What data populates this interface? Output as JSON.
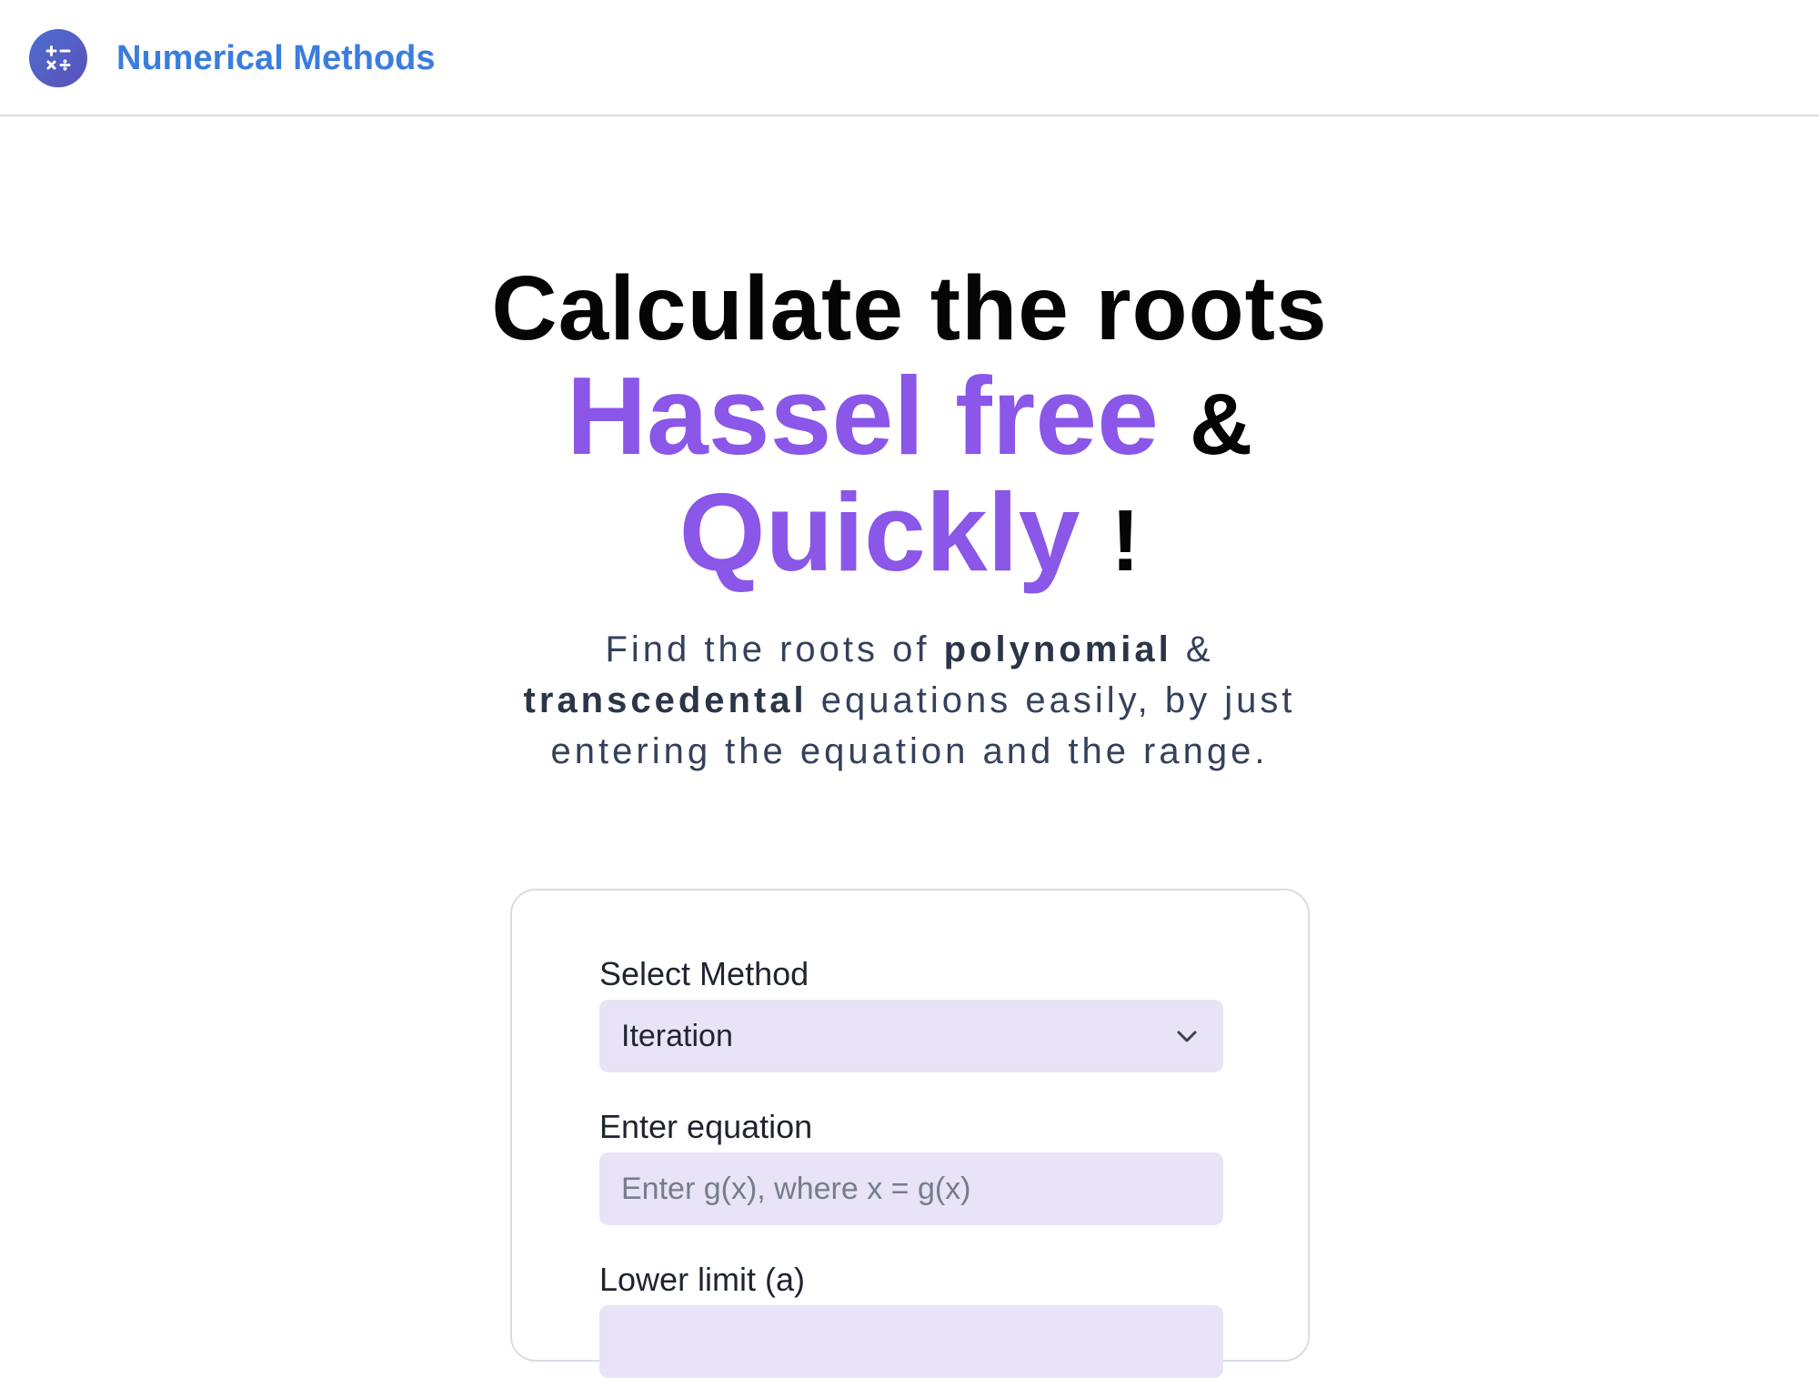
{
  "brand": {
    "name": "Numerical Methods",
    "logo_icon": "calculator-icon",
    "color": "#3b7ddd"
  },
  "hero": {
    "line1": "Calculate the roots",
    "line2_accent": "Hassel free",
    "line2_rest": "&",
    "line3_accent": "Quickly",
    "line3_rest": "!",
    "accent_color": "#8a57e8"
  },
  "subtitle": {
    "t1": "Find the roots of ",
    "b1": "polynomial",
    "t2": " & ",
    "b2": "transcedental",
    "t3": " equations easily, by just entering the equation and the range."
  },
  "form": {
    "method_label": "Select Method",
    "method_value": "Iteration",
    "method_icon": "chevron-down-icon",
    "equation_label": "Enter equation",
    "equation_placeholder": "Enter g(x), where x = g(x)",
    "lower_label": "Lower limit (a)",
    "field_color": "#e8e3f7"
  }
}
